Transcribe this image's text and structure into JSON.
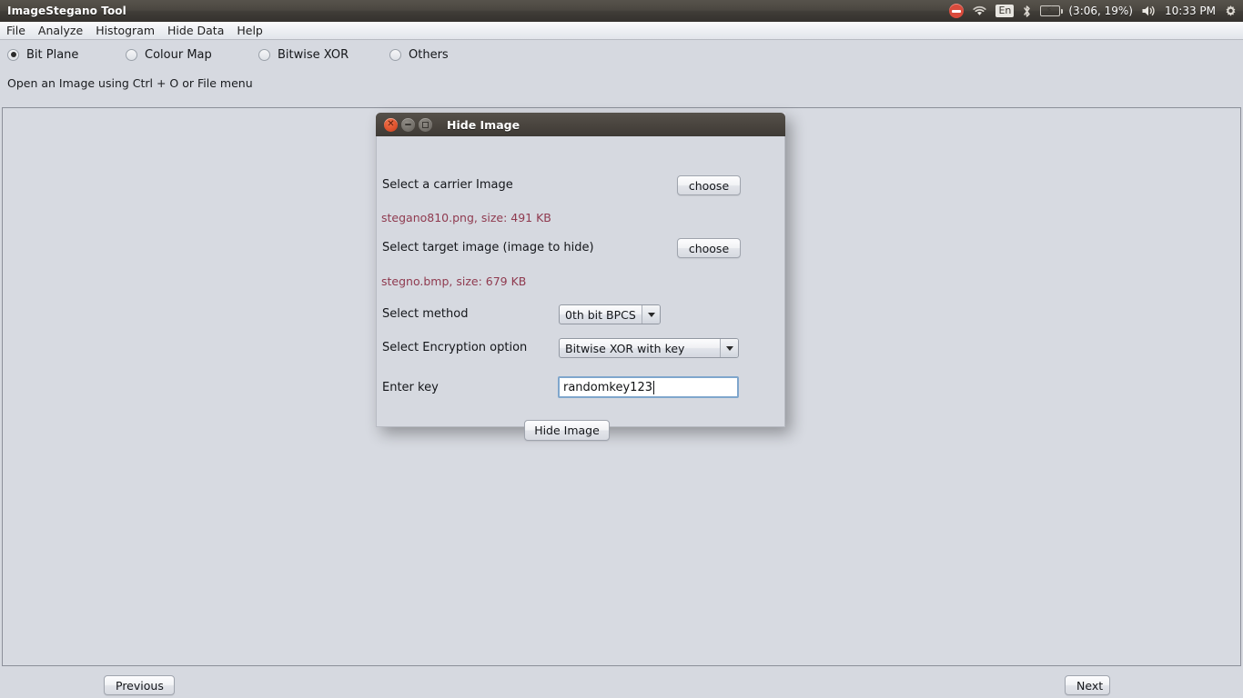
{
  "system_panel": {
    "title": "ImageStegano Tool",
    "tray": {
      "stop_icon": "stop-icon",
      "wifi_icon": "wifi-icon",
      "language": "En",
      "bluetooth_icon": "bluetooth-icon",
      "battery_icon": "battery-charging-icon",
      "battery_status": "(3:06, 19%)",
      "volume_icon": "volume-icon",
      "clock": "10:33 PM",
      "settings_icon": "gear-icon"
    }
  },
  "menubar": {
    "items": [
      {
        "label": "File"
      },
      {
        "label": "Analyze"
      },
      {
        "label": "Histogram"
      },
      {
        "label": "Hide Data"
      },
      {
        "label": "Help"
      }
    ]
  },
  "options": {
    "radios": [
      {
        "label": "Bit Plane",
        "selected": true
      },
      {
        "label": "Colour Map",
        "selected": false
      },
      {
        "label": "Bitwise XOR",
        "selected": false
      },
      {
        "label": "Others",
        "selected": false
      }
    ]
  },
  "hint": "Open an Image using Ctrl + O or File menu",
  "footer": {
    "previous_label": "Previous",
    "next_label": "Next"
  },
  "dialog": {
    "title": "Hide Image",
    "window_buttons": {
      "close": "close-icon",
      "minimize": "minimize-icon",
      "maximize": "maximize-icon"
    },
    "carrier": {
      "label": "Select a carrier Image",
      "button_label": "choose",
      "file_info": "stegano810.png, size: 491 KB"
    },
    "target": {
      "label": "Select target image (image to hide)",
      "button_label": "choose",
      "file_info": "stegno.bmp, size: 679 KB"
    },
    "method": {
      "label": "Select method",
      "selected": "0th bit BPCS"
    },
    "encryption": {
      "label": "Select Encryption option",
      "selected": "Bitwise XOR with key"
    },
    "key": {
      "label": "Enter key",
      "value": "randomkey123",
      "placeholder": ""
    },
    "submit_label": "Hide Image"
  },
  "colors": {
    "panel_dark": "#4a453f",
    "app_bg": "#d6d9e0",
    "file_info_text": "#8f3a4f",
    "focus_border": "#7fa6cc",
    "close_button": "#e0542f"
  }
}
